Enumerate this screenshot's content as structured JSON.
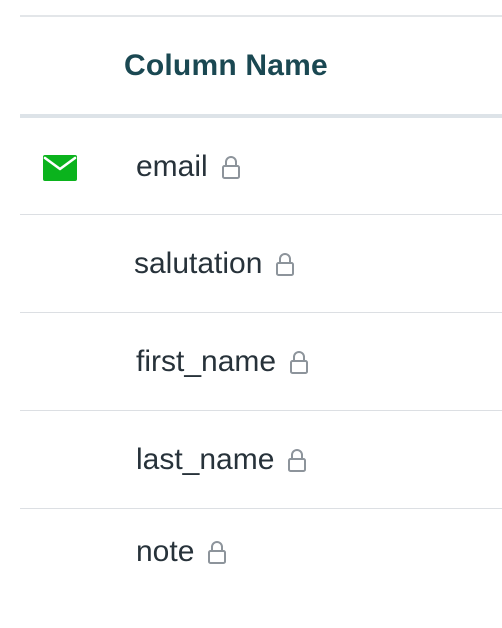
{
  "header": {
    "column_name_label": "Column Name"
  },
  "rows": [
    {
      "name": "email",
      "has_mail_icon": true,
      "locked": true
    },
    {
      "name": "salutation",
      "has_mail_icon": false,
      "locked": true
    },
    {
      "name": "first_name",
      "has_mail_icon": false,
      "locked": true
    },
    {
      "name": "last_name",
      "has_mail_icon": false,
      "locked": true
    },
    {
      "name": "note",
      "has_mail_icon": false,
      "locked": true
    }
  ],
  "colors": {
    "header_text": "#1a4852",
    "mail_icon": "#0bb31d",
    "lock_icon": "#8d949b",
    "row_text": "#27323a"
  },
  "icons": {
    "email_marker": "envelope-icon",
    "locked_marker": "lock-icon"
  }
}
